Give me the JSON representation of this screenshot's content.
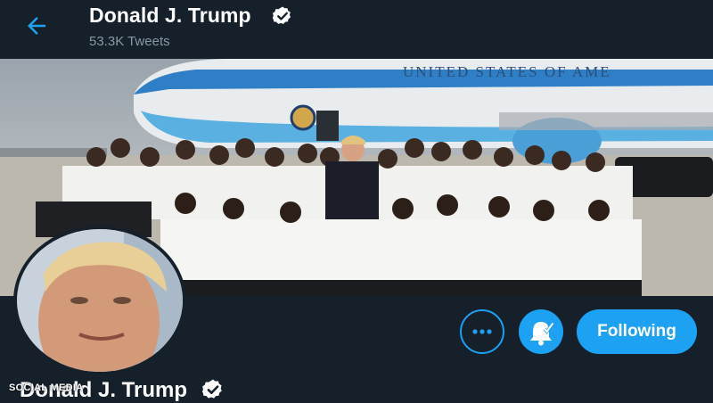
{
  "header": {
    "name": "Donald J. Trump",
    "tweet_count": "53.3K Tweets",
    "back_icon": "arrow-left-icon",
    "verified_icon": "verified-badge-icon"
  },
  "banner": {
    "plane_text": "UNITED STATES OF AME"
  },
  "profile": {
    "name": "Donald J. Trump"
  },
  "actions": {
    "more_icon": "more-icon",
    "notify_icon": "notification-bell-icon",
    "follow_label": "Following"
  },
  "watermark": "SOCIAL MEDIA",
  "colors": {
    "background": "#15202b",
    "accent": "#1da1f2",
    "muted_text": "#8899a6"
  }
}
